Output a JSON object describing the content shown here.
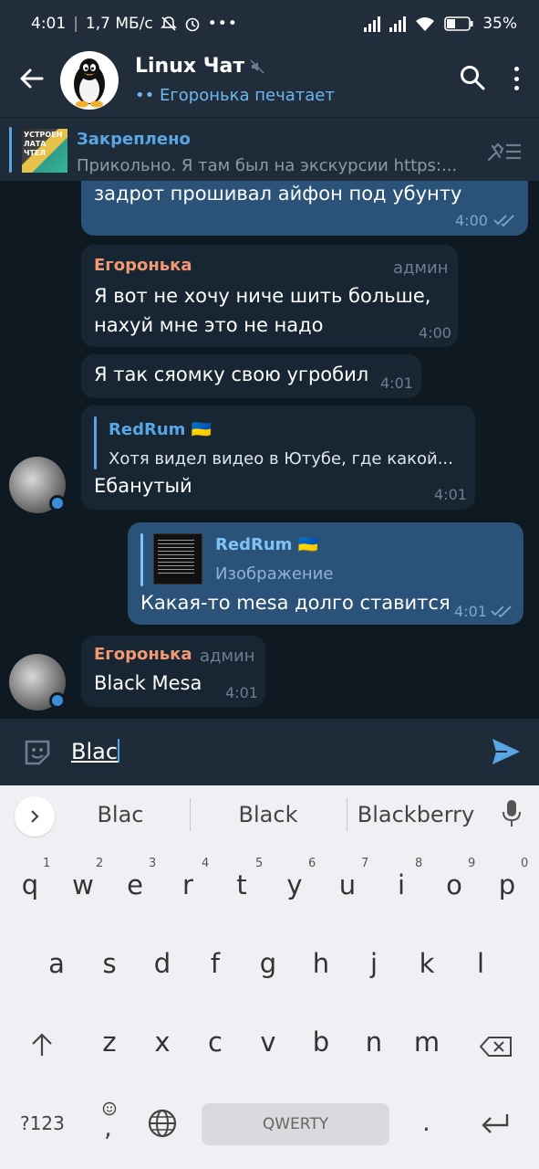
{
  "status": {
    "time": "4:01",
    "speed": "1,7 МБ/с",
    "battery": "35%",
    "icons": [
      "silent-bell-icon",
      "alarm-icon",
      "more-dots-icon",
      "signal-icon",
      "wifi-icon",
      "battery-icon"
    ]
  },
  "header": {
    "title": "Linux Чат",
    "typing": "Егоронька печатает"
  },
  "pinned": {
    "label": "Закреплено",
    "text": "Прикольно. Я там был на экскурсии https:...",
    "thumb_text": "УСТРОЕН ЛАТА ЧТЕЛ"
  },
  "messages": [
    {
      "id": "m1",
      "dir": "out",
      "lines": [
        "задрот прошивал айфон под убунту"
      ],
      "time": "4:00",
      "read": true
    },
    {
      "id": "m2",
      "dir": "in",
      "sender": "Егоронька",
      "role": "админ",
      "lines": [
        "Я вот не хочу ниче шить больше,",
        "нахуй мне это не надо"
      ],
      "time": "4:00"
    },
    {
      "id": "m3",
      "dir": "in",
      "lines": [
        "Я так сяомку свою угробил"
      ],
      "time": "4:01"
    },
    {
      "id": "m4",
      "dir": "in",
      "reply": {
        "name": "RedRum 🇺🇦",
        "text": "Хотя видел видео в Ютубе, где какой..."
      },
      "lines": [
        "Ебанутый"
      ],
      "time": "4:01"
    },
    {
      "id": "m5",
      "dir": "out",
      "reply": {
        "name": "RedRum 🇺🇦",
        "text": "Изображение"
      },
      "lines": [
        "Какая-то mesa долго ставится"
      ],
      "time": "4:01",
      "read": true
    },
    {
      "id": "m6",
      "dir": "in",
      "sender": "Егоронька",
      "role": "админ",
      "lines": [
        "Black Mesa"
      ],
      "time": "4:01"
    }
  ],
  "composer": {
    "value": "Blac"
  },
  "keyboard": {
    "suggestions": [
      "Blac",
      "Black",
      "Blackberry"
    ],
    "row1": [
      "q",
      "w",
      "e",
      "r",
      "t",
      "y",
      "u",
      "i",
      "o",
      "p"
    ],
    "row1_nums": [
      "1",
      "2",
      "3",
      "4",
      "5",
      "6",
      "7",
      "8",
      "9",
      "0"
    ],
    "row2": [
      "a",
      "s",
      "d",
      "f",
      "g",
      "h",
      "j",
      "k",
      "l"
    ],
    "row3": [
      "z",
      "x",
      "c",
      "v",
      "b",
      "n",
      "m"
    ],
    "sym": "?123",
    "comma": ",",
    "space": "QWERTY",
    "period": "."
  },
  "colors": {
    "bg": "#0f1921",
    "header": "#212d3b",
    "bubble_in": "#182533",
    "bubble_out": "#2b5278",
    "accent": "#5aa6e4",
    "sender": "#f29873"
  }
}
